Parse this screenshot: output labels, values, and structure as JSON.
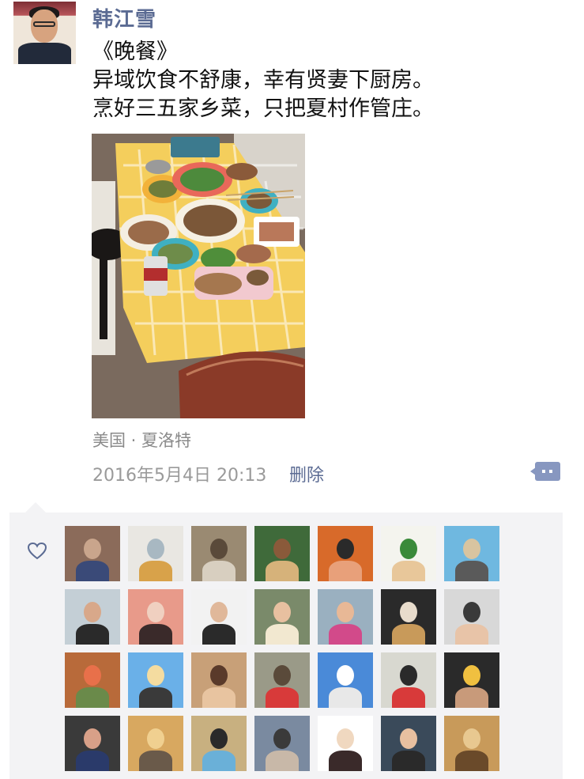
{
  "post": {
    "author": "韩江雪",
    "lines": [
      "《晚餐》",
      "异域饮食不舒康，幸有贤妻下厨房。",
      "烹好三五家乡菜，只把夏村作管庄。"
    ],
    "location": "美国 · 夏洛特",
    "timestamp": "2016年5月4日 20:13",
    "delete_label": "删除",
    "comment_icon": "more-dots-icon"
  },
  "likes": {
    "icon": "heart-outline-icon",
    "accent_color": "#5b6b93",
    "count": 28
  }
}
